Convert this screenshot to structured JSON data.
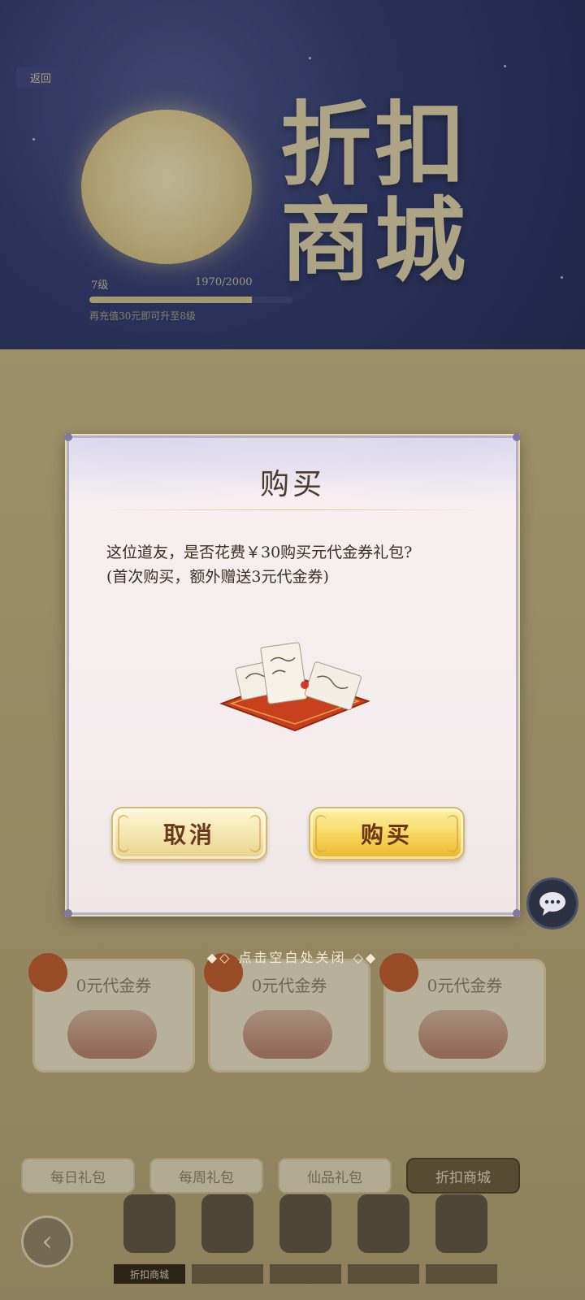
{
  "background": {
    "back_tag": "返回",
    "banner_title": "折扣商城",
    "progress": {
      "label": "7级",
      "value": "1970/2000",
      "fraction": 0.8,
      "hint": "再充值30元即可升至8级"
    },
    "cards": [
      {
        "title": "0元代金券"
      },
      {
        "title": "0元代金券"
      },
      {
        "title": "0元代金券"
      }
    ],
    "tabs": [
      "每日礼包",
      "每周礼包",
      "仙品礼包",
      "折扣商城"
    ],
    "active_tab": 3,
    "nav_items": [
      "折扣商城",
      "",
      "",
      "",
      ""
    ],
    "nav_back_icon": "‹"
  },
  "dialog": {
    "title": "购买",
    "message_line1": "这位道友，是否花费￥30购买元代金券礼包?",
    "message_line2": "(首次购买，额外赠送3元代金券)",
    "cancel_label": "取消",
    "buy_label": "购买"
  },
  "close_hint": "◆◇ 点击空白处关闭 ◇◆",
  "colors": {
    "dialog_bg": "#f5eeee",
    "buy_gold": "#f6d55a",
    "cancel_cream": "#f3e3a8",
    "text_brown": "#3b2f25"
  }
}
